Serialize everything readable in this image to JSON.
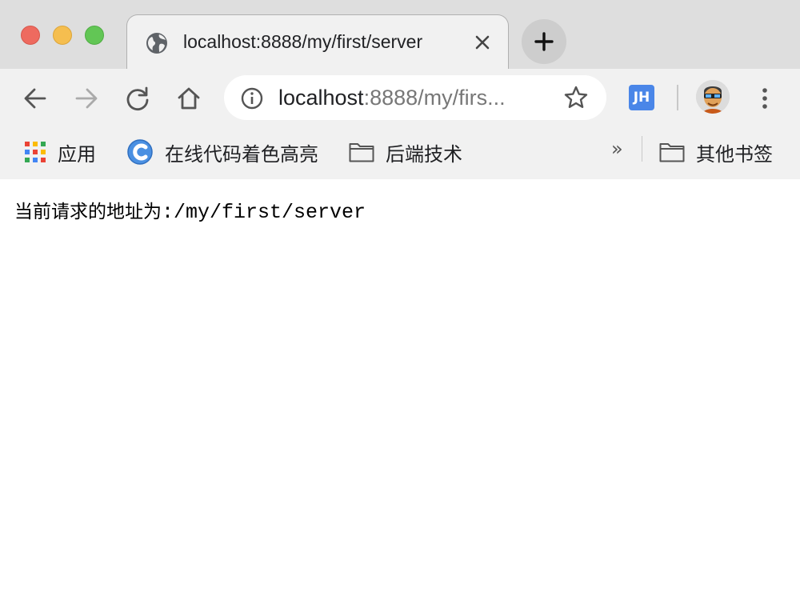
{
  "tab": {
    "title": "localhost:8888/my/first/server"
  },
  "omnibox": {
    "host": "localhost",
    "path": ":8888/my/firs..."
  },
  "extensions": {
    "jh_label": "JH"
  },
  "bookmarks": {
    "apps_label": "应用",
    "items": [
      {
        "label": "在线代码着色高亮",
        "icon": "c-logo-icon"
      },
      {
        "label": "后端技术",
        "icon": "folder-icon"
      }
    ],
    "overflow": "»",
    "other_label": "其他书签"
  },
  "page": {
    "prefix": "当前请求的地址为",
    "path": ":/my/first/server"
  },
  "colors": {
    "close": "#ee6a5f",
    "minimize": "#f5be4f",
    "maximize": "#62c655",
    "jh_badge": "#4a86e8",
    "c_logo": "#4a90e2"
  }
}
